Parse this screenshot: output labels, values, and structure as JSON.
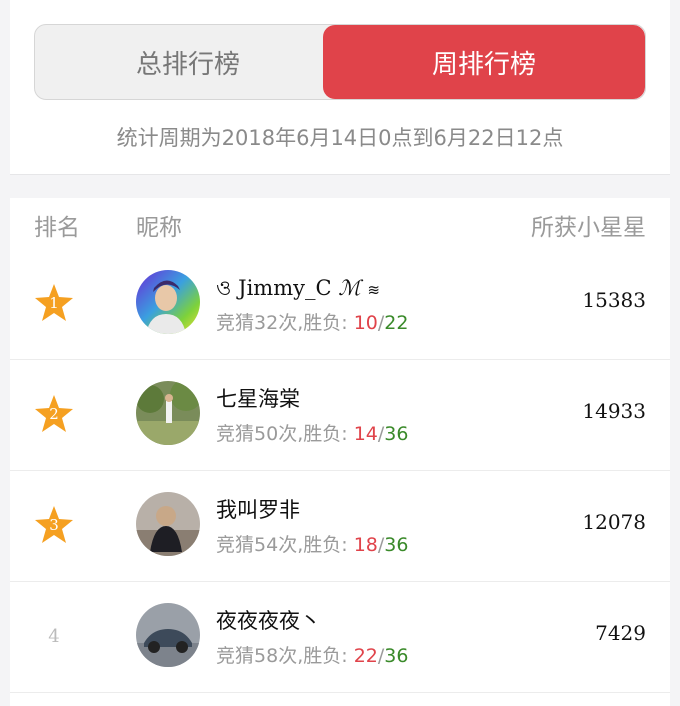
{
  "tabs": {
    "total_label": "总排行榜",
    "weekly_label": "周排行榜"
  },
  "period_text": "统计周期为2018年6月14日0点到6月22日12点",
  "table_header": {
    "rank": "排名",
    "nickname": "昵称",
    "stars": "所获小星星"
  },
  "record_prefix": "竞猜",
  "record_mid": "次,胜负: ",
  "rows": [
    {
      "rank": "1",
      "nickname": "Jimmy_C",
      "nick_prefix": "ও",
      "nick_suffix": "ℳ",
      "guesses": "32",
      "wins": "10",
      "losses": "22",
      "stars": "15383"
    },
    {
      "rank": "2",
      "nickname": "七星海棠",
      "guesses": "50",
      "wins": "14",
      "losses": "36",
      "stars": "14933"
    },
    {
      "rank": "3",
      "nickname": "我叫罗非",
      "guesses": "54",
      "wins": "18",
      "losses": "36",
      "stars": "12078"
    },
    {
      "rank": "4",
      "nickname": "夜夜夜夜丶",
      "guesses": "58",
      "wins": "22",
      "losses": "36",
      "stars": "7429"
    }
  ],
  "colors": {
    "accent": "#e0434a",
    "win": "#e0434a",
    "loss": "#3a8a2a",
    "star": "#f5a021"
  }
}
